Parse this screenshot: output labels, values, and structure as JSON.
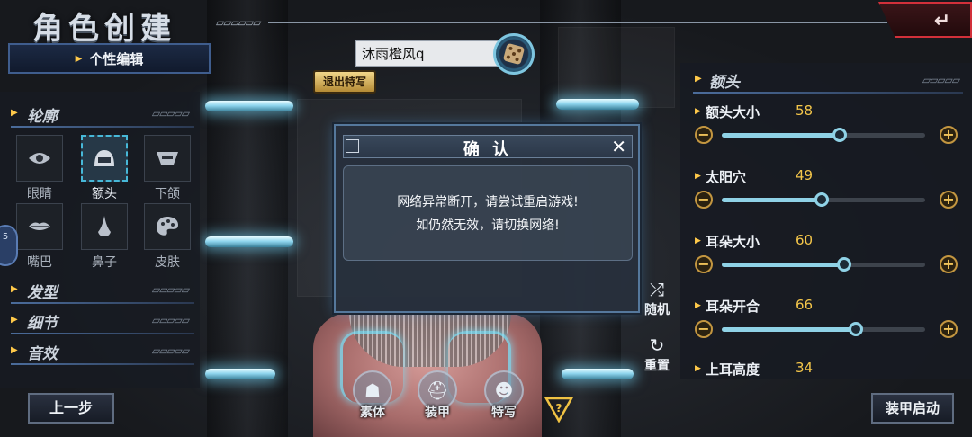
{
  "title": "角色创建",
  "edit_tab": "个性编辑",
  "name_input_value": "沐雨橙风q",
  "exit_special": "退出特写",
  "left_sections": [
    {
      "label": "轮廓"
    },
    {
      "label": "发型"
    },
    {
      "label": "细节"
    },
    {
      "label": "音效"
    }
  ],
  "features": [
    {
      "label": "眼睛",
      "icon": "eye-icon"
    },
    {
      "label": "额头",
      "icon": "forehead-icon"
    },
    {
      "label": "下颌",
      "icon": "jaw-icon"
    },
    {
      "label": "嘴巴",
      "icon": "mouth-icon"
    },
    {
      "label": "鼻子",
      "icon": "nose-icon"
    },
    {
      "label": "皮肤",
      "icon": "palette-icon"
    }
  ],
  "side_badge": "5",
  "prev_button": "上一步",
  "dialog": {
    "title": "确 认",
    "line1": "网络异常断开，请尝试重启游戏!",
    "line2": "如仍然无效，请切换网络!"
  },
  "modes": [
    {
      "label": "素体"
    },
    {
      "label": "装甲"
    },
    {
      "label": "特写"
    }
  ],
  "random_label": "随机",
  "reset_label": "重置",
  "right_section": "额头",
  "sliders": [
    {
      "name": "额头大小",
      "value": 58
    },
    {
      "name": "太阳穴",
      "value": 49
    },
    {
      "name": "耳朵大小",
      "value": 60
    },
    {
      "name": "耳朵开合",
      "value": 66
    },
    {
      "name": "上耳高度",
      "value": 34
    }
  ],
  "start_button": "装甲启动",
  "colors": {
    "accent_yellow": "#ffc94a",
    "accent_cyan": "#8fd2e6",
    "back_red": "#d2303a"
  }
}
